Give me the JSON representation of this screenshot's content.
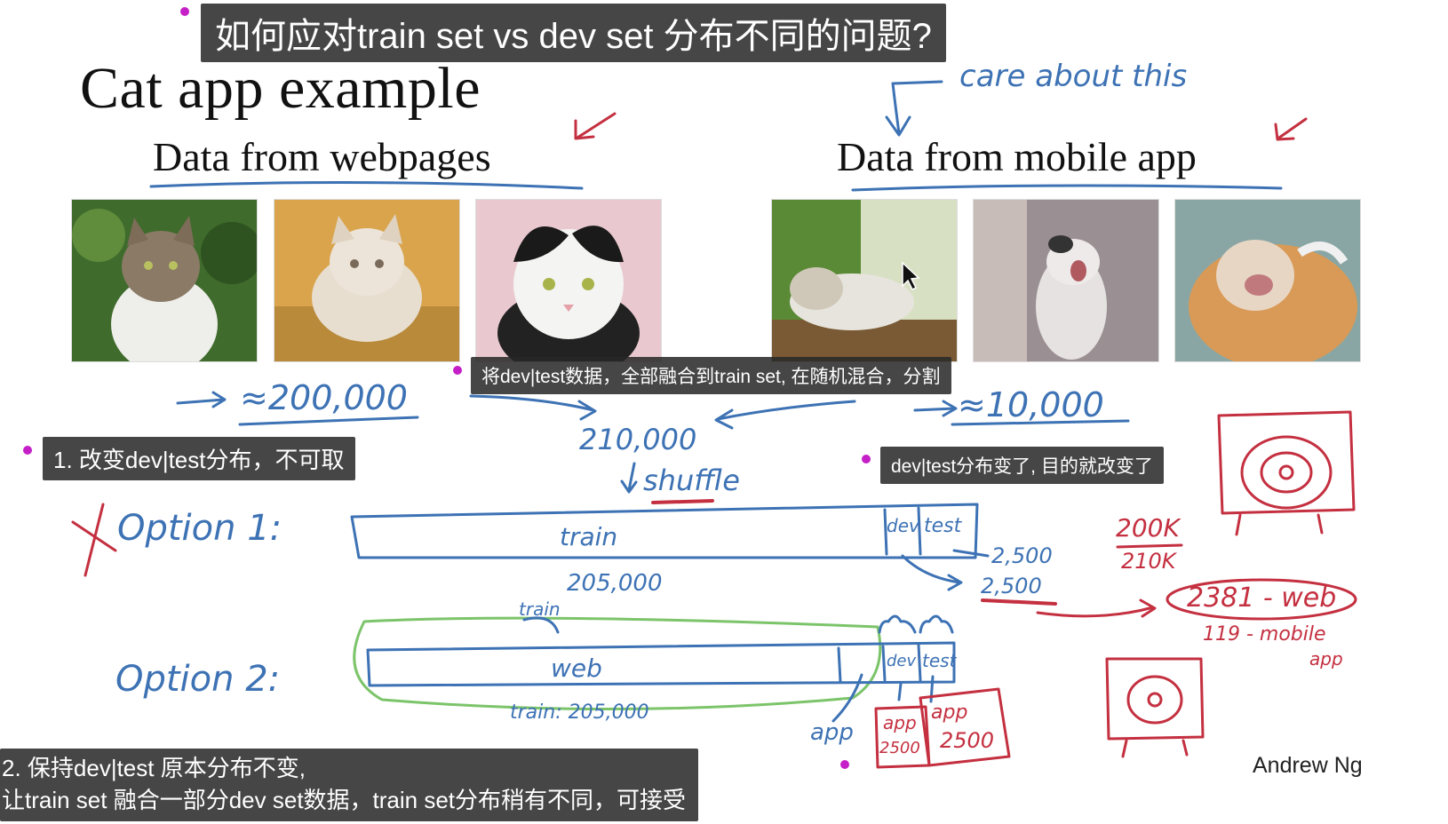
{
  "slide": {
    "title": "Cat app example",
    "web_heading": "Data from webpages",
    "mobile_heading": "Data from mobile app",
    "author": "Andrew Ng"
  },
  "captions": {
    "title": "如何应对train set vs dev set 分布不同的问题?",
    "mix": "将dev|test数据，全部融合到train set, 在随机混合，分割",
    "option1": "1. 改变dev|test分布，不可取",
    "dist_changed": "dev|test分布变了, 目的就改变了",
    "option2_line1": "2. 保持dev|test 原本分布不变,",
    "option2_line2": "让train set 融合一部分dev set数据，train set分布稍有不同，可接受"
  },
  "handwriting": {
    "care": "care about this",
    "web_count": "≈200,000",
    "mobile_count": "≈10,000",
    "total": "210,000",
    "shuffle": "shuffle",
    "option1": "Option 1:",
    "option2": "Option 2:",
    "train": "train",
    "dev": "dev",
    "test": "test",
    "count_2500_a": "2,500",
    "count_2500_b": "2,500",
    "count_205000": "205,000",
    "train_205000": "train: 205,000",
    "ratio_top": "200K",
    "ratio_bottom": "210K",
    "web_2381": "2381 - web",
    "mobile_119": "119 - mobile",
    "app_word": "app",
    "web": "web",
    "app_label": "app",
    "app_box1_label": "app",
    "app_box1_count": "2500",
    "app_box2_label": "app",
    "app_box2_count": "2500"
  },
  "colors": {
    "blue_ink": "#3d72b4",
    "red_ink": "#c43040",
    "green_ink": "#7cc46a",
    "caption_bg": "#282828",
    "caption_dot": "#c51fc8"
  },
  "icons": [
    "cat-photo",
    "target-icon",
    "cursor-icon"
  ]
}
